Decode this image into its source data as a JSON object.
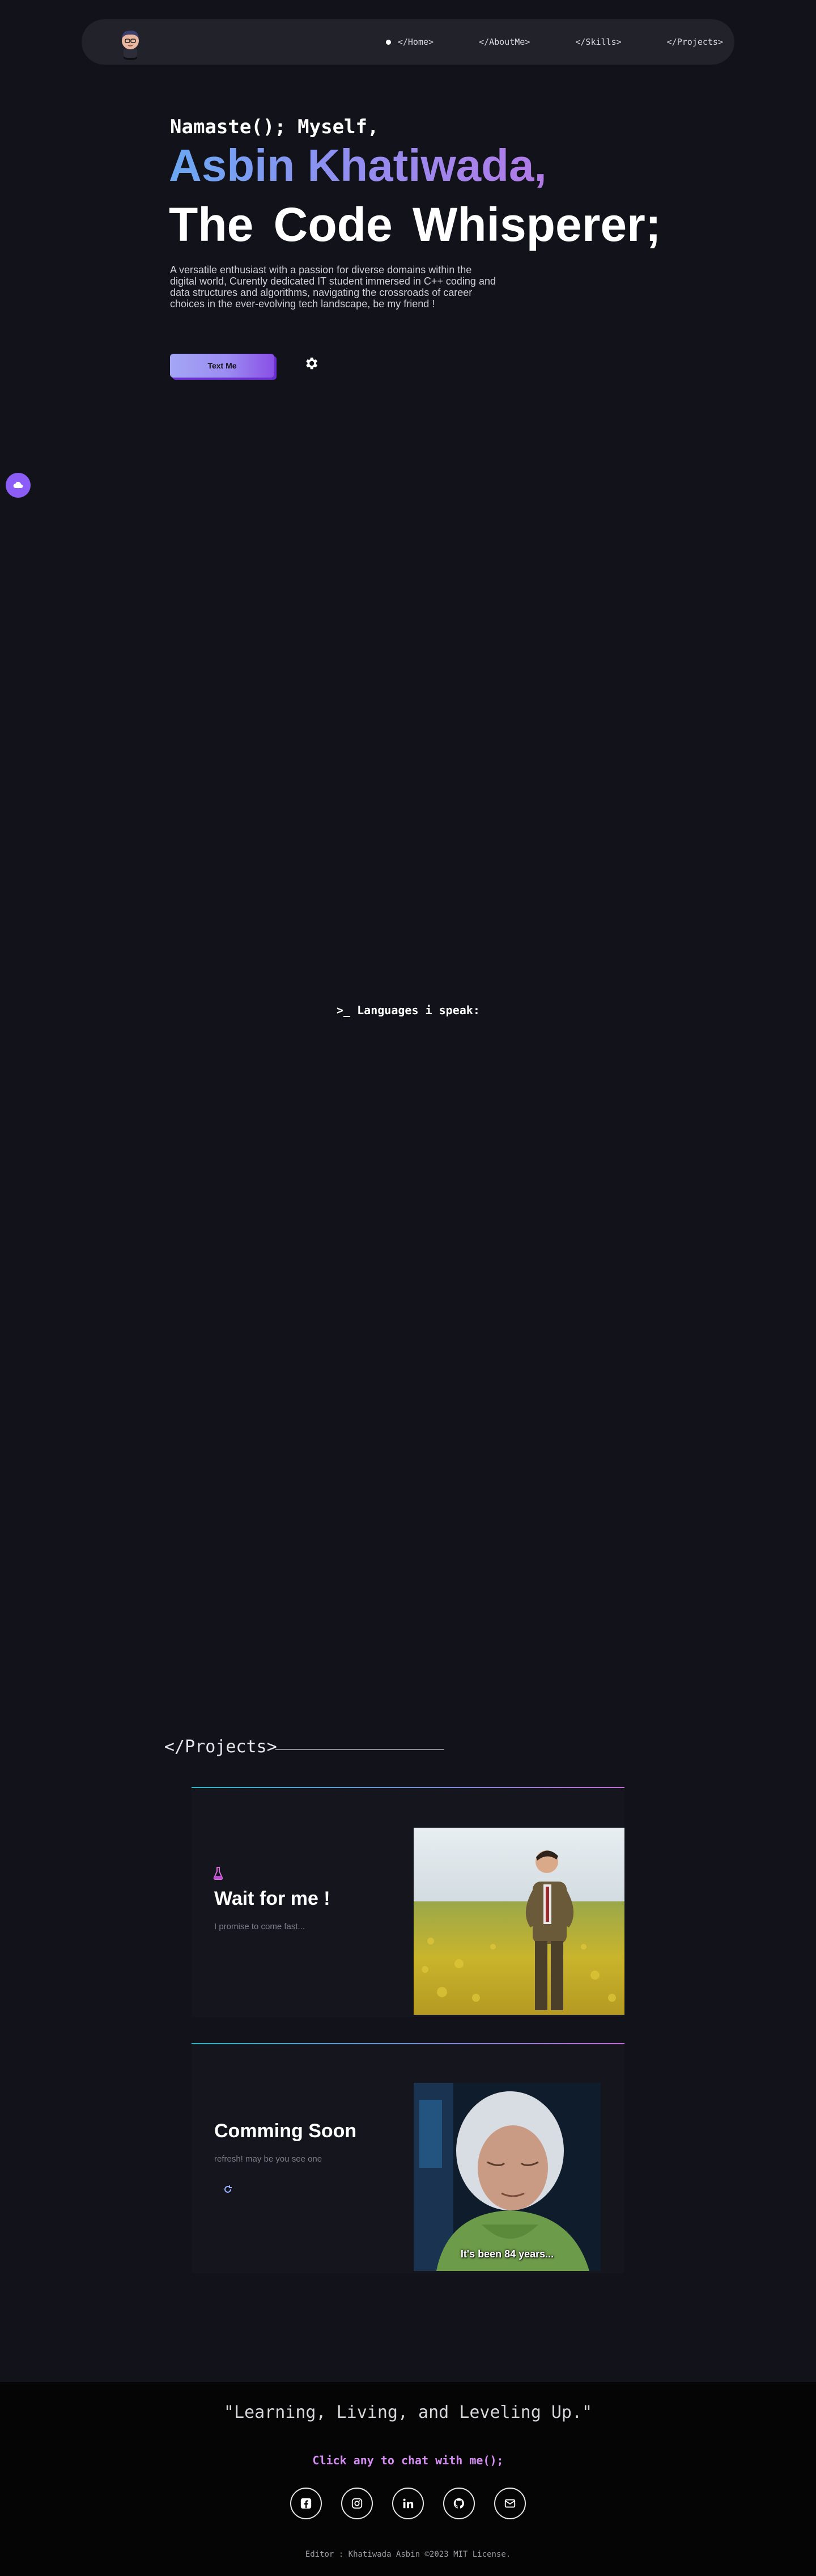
{
  "nav": {
    "links": [
      {
        "label": "</Home>"
      },
      {
        "label": "</AboutMe>"
      },
      {
        "label": "</Skills>"
      },
      {
        "label": "</Projects>"
      }
    ]
  },
  "hero": {
    "greeting": "Namaste(); Myself,",
    "name": "Asbin Khatiwada,",
    "title": "The Code Whisperer;",
    "description": "A versatile enthusiast with a passion for diverse domains within the digital world, Curently dedicated IT student immersed in C++ coding and data structures and algorithms, navigating the crossroads of career choices in the ever-evolving tech landscape, be my friend !",
    "cta_label": "Text Me"
  },
  "languages": {
    "heading": ">_ Languages i speak:"
  },
  "projects": {
    "heading": "</Projects>",
    "items": [
      {
        "title": "Wait for me !",
        "subtitle": "I promise to come fast...",
        "icon": "flask-icon"
      },
      {
        "title": "Comming Soon",
        "subtitle": "refresh! may be you see one",
        "icon": "refresh-icon",
        "image_caption": "It's been 84 years..."
      }
    ]
  },
  "footer": {
    "quote": "\"Learning, Living, and Leveling Up.\"",
    "chat_cta": "Click any to chat with me();",
    "socials": [
      "facebook-icon",
      "instagram-icon",
      "linkedin-icon",
      "github-icon",
      "mail-icon"
    ],
    "copyright": "Editor : Khatiwada Asbin ©2023 MIT License."
  },
  "colors": {
    "background": "#12121b",
    "accent_purple": "#8b5cf6",
    "name_gradient_start": "#6aa8f2",
    "name_gradient_end": "#b27ae6",
    "chat_cta": "#d48cf0"
  }
}
